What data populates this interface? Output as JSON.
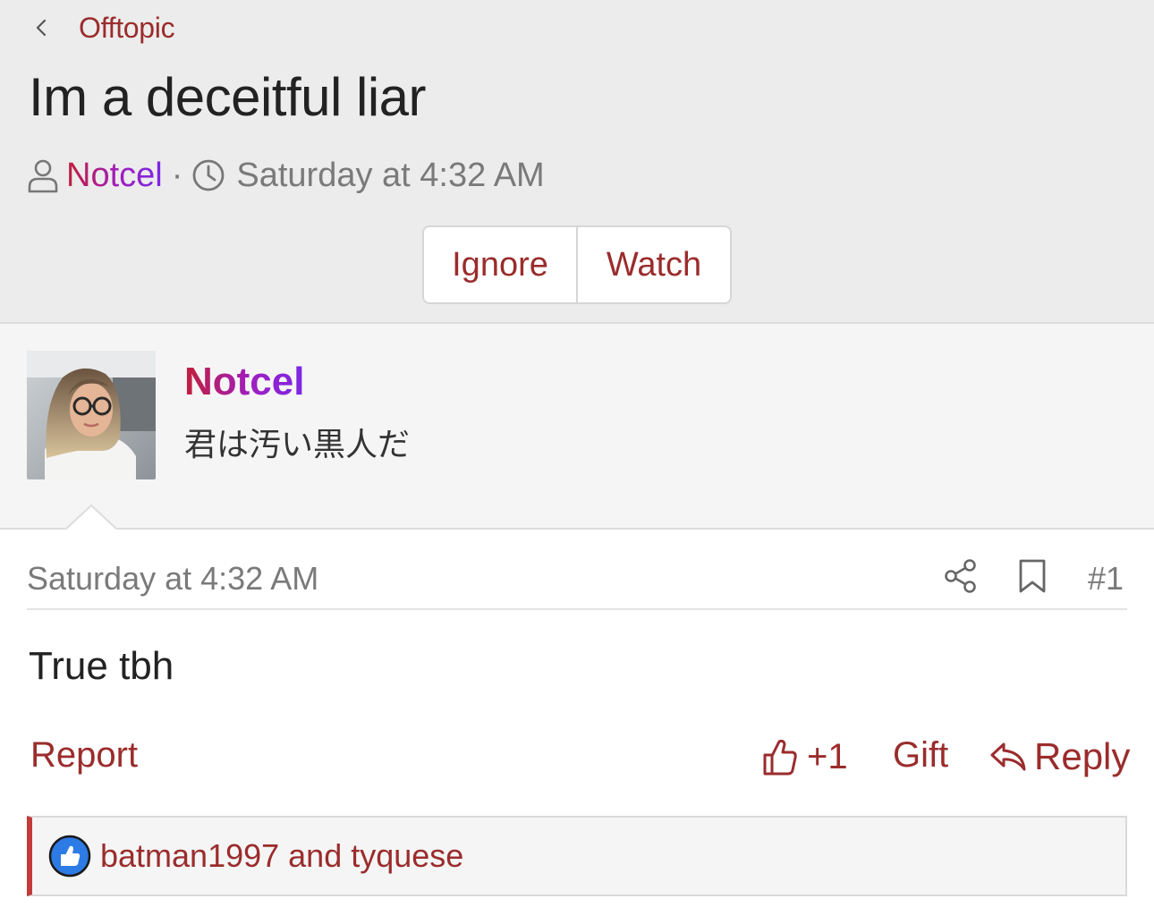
{
  "header": {
    "breadcrumb": "Offtopic",
    "title": "Im a deceitful liar",
    "author": "Notcel",
    "separator": "·",
    "timestamp": "Saturday at 4:32 AM",
    "buttons": {
      "ignore": "Ignore",
      "watch": "Watch"
    }
  },
  "author_block": {
    "name": "Notcel",
    "user_title": "君は汚い黒人だ"
  },
  "post": {
    "date": "Saturday at 4:32 AM",
    "number": "#1",
    "body": "True tbh",
    "actions": {
      "report": "Report",
      "like": "+1",
      "gift": "Gift",
      "reply": "Reply"
    },
    "reactions": "batman1997 and tyquese"
  },
  "colors": {
    "accent": "#9b2c2c",
    "header_bg": "#ececec",
    "author_bg": "#f5f5f5",
    "reaction_bar": "#c33b3b",
    "like_badge": "#2d7be5"
  },
  "icons": [
    "chevron-left-icon",
    "user-icon",
    "clock-icon",
    "share-icon",
    "bookmark-icon",
    "thumbs-up-icon",
    "reply-icon",
    "like-reaction-icon"
  ]
}
